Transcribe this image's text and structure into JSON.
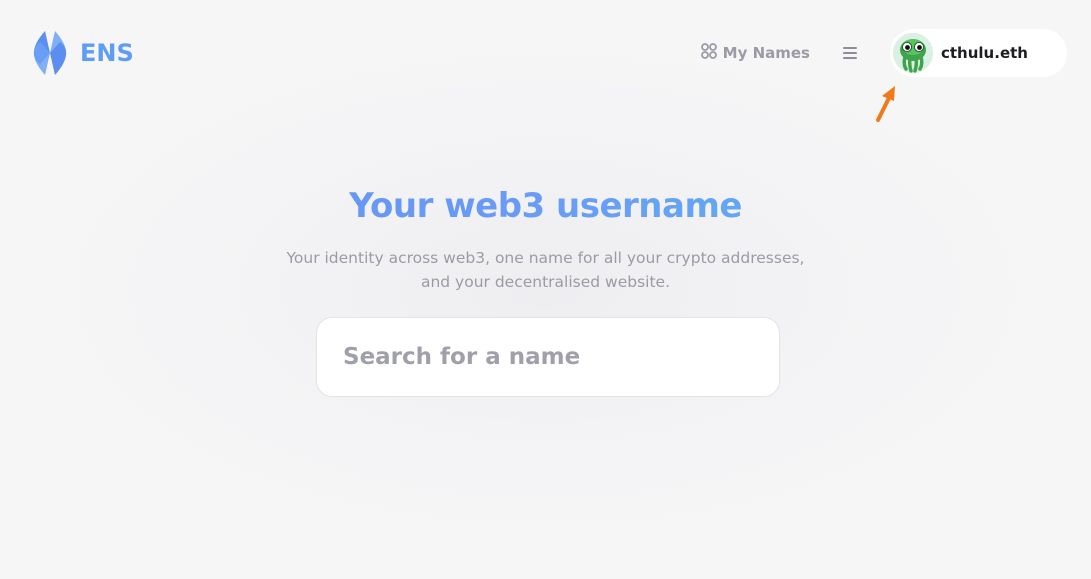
{
  "header": {
    "logo_text": "ENS",
    "logo_icon": "ens-logo-icon",
    "my_names_label": "My Names",
    "my_names_icon": "grid-icon",
    "menu_icon": "hamburger-menu-icon",
    "profile": {
      "name": "cthulu.eth",
      "avatar_icon": "cthulhu-avatar"
    },
    "pointer_icon": "arrow-pointer-icon"
  },
  "hero": {
    "title": "Your web3 username",
    "subtitle_line1": "Your identity across web3, one name for all your crypto addresses,",
    "subtitle_line2": "and your decentralised website."
  },
  "search": {
    "placeholder": "Search for a name",
    "value": ""
  },
  "colors": {
    "brand": "#5f9cf3",
    "title_gradient_start": "#5d8ff1",
    "title_gradient_end": "#56b8f0",
    "muted_text": "#9b9ba5",
    "arrow": "#f07a1a"
  }
}
